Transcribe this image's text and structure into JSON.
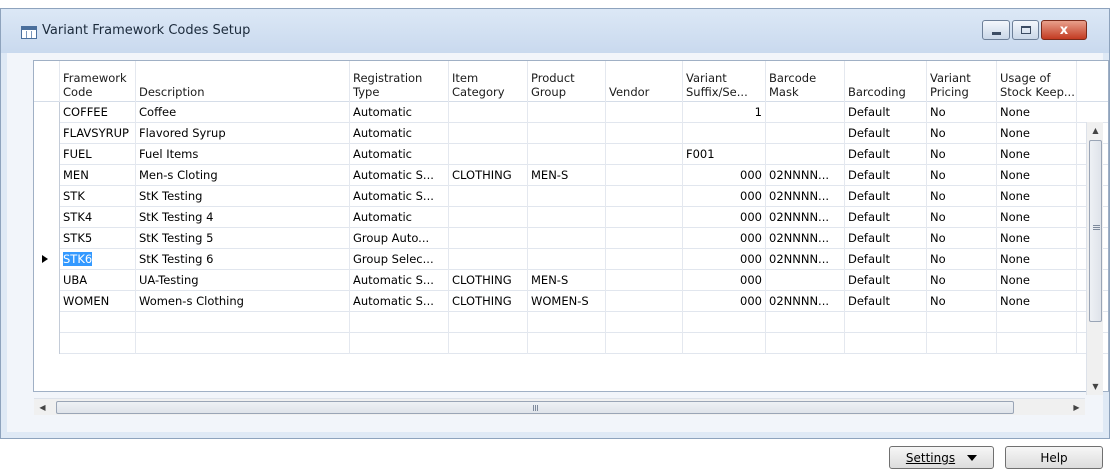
{
  "window": {
    "title": "Variant Framework Codes Setup",
    "controls": {
      "minimize_icon": "minimize-icon",
      "maximize_icon": "maximize-icon",
      "close_label": "x"
    }
  },
  "columns": [
    "Framework\nCode",
    "Description",
    "Registration\nType",
    "Item\nCategory",
    "Product\nGroup",
    "Vendor",
    "Variant\nSuffix/Se...",
    "Barcode\nMask",
    "Barcoding",
    "Variant\nPricing",
    "Usage of\nStock Keep..."
  ],
  "rows": [
    {
      "code": "COFFEE",
      "description": "Coffee",
      "registration_type": "Automatic",
      "item_category": "",
      "product_group": "",
      "vendor": "",
      "variant_suffix": "1",
      "barcode_mask": "",
      "barcoding": "Default",
      "variant_pricing": "No",
      "usage": "None"
    },
    {
      "code": "FLAVSYRUP",
      "description": "Flavored Syrup",
      "registration_type": "Automatic",
      "item_category": "",
      "product_group": "",
      "vendor": "",
      "variant_suffix": "",
      "barcode_mask": "",
      "barcoding": "Default",
      "variant_pricing": "No",
      "usage": "None"
    },
    {
      "code": "FUEL",
      "description": "Fuel Items",
      "registration_type": "Automatic",
      "item_category": "",
      "product_group": "",
      "vendor": "",
      "variant_suffix": "F001",
      "barcode_mask": "",
      "barcoding": "Default",
      "variant_pricing": "No",
      "usage": "None"
    },
    {
      "code": "MEN",
      "description": "Men-s Cloting",
      "registration_type": "Automatic S...",
      "item_category": "CLOTHING",
      "product_group": "MEN-S",
      "vendor": "",
      "variant_suffix": "000",
      "barcode_mask": "02NNNN...",
      "barcoding": "Default",
      "variant_pricing": "No",
      "usage": "None"
    },
    {
      "code": "STK",
      "description": "StK Testing",
      "registration_type": "Automatic S...",
      "item_category": "",
      "product_group": "",
      "vendor": "",
      "variant_suffix": "000",
      "barcode_mask": "02NNNN...",
      "barcoding": "Default",
      "variant_pricing": "No",
      "usage": "None"
    },
    {
      "code": "STK4",
      "description": "StK Testing 4",
      "registration_type": "Automatic",
      "item_category": "",
      "product_group": "",
      "vendor": "",
      "variant_suffix": "000",
      "barcode_mask": "02NNNN...",
      "barcoding": "Default",
      "variant_pricing": "No",
      "usage": "None"
    },
    {
      "code": "STK5",
      "description": "StK Testing 5",
      "registration_type": "Group Auto...",
      "item_category": "",
      "product_group": "",
      "vendor": "",
      "variant_suffix": "000",
      "barcode_mask": "02NNNN...",
      "barcoding": "Default",
      "variant_pricing": "No",
      "usage": "None"
    },
    {
      "code": "STK6",
      "description": "StK Testing 6",
      "registration_type": "Group Selec...",
      "item_category": "",
      "product_group": "",
      "vendor": "",
      "variant_suffix": "000",
      "barcode_mask": "02NNNN...",
      "barcoding": "Default",
      "variant_pricing": "No",
      "usage": "None",
      "selected": true
    },
    {
      "code": "UBA",
      "description": "UA-Testing",
      "registration_type": "Automatic S...",
      "item_category": "CLOTHING",
      "product_group": "MEN-S",
      "vendor": "",
      "variant_suffix": "000",
      "barcode_mask": "",
      "barcoding": "Default",
      "variant_pricing": "No",
      "usage": "None"
    },
    {
      "code": "WOMEN",
      "description": "Women-s Clothing",
      "registration_type": "Automatic S...",
      "item_category": "CLOTHING",
      "product_group": "WOMEN-S",
      "vendor": "",
      "variant_suffix": "000",
      "barcode_mask": "02NNNN...",
      "barcoding": "Default",
      "variant_pricing": "No",
      "usage": "None"
    }
  ],
  "empty_rows": 2,
  "scrollbar": {
    "horizontal_grip": "III",
    "vertical_grip": "≡"
  },
  "buttons": {
    "settings": "Settings",
    "help": "Help"
  },
  "colors": {
    "selection": "#3399ff",
    "close_button": "#c33b22"
  }
}
